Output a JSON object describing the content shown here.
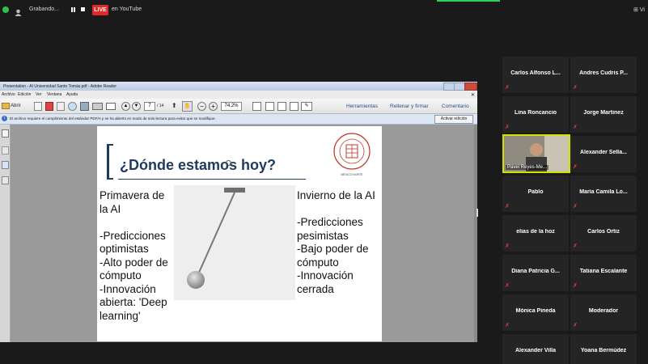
{
  "topbar": {
    "recording_label": "Grabando...",
    "live_badge": "LIVE",
    "stream_label": "en YouTube",
    "view_label": "Vi"
  },
  "reader": {
    "window_title": "Presentation - AI Universidad Santo Tomás.pdf - Adobe Reader",
    "menu": [
      "Archivo",
      "Edición",
      "Ver",
      "Ventana",
      "Ayuda"
    ],
    "open_label": "Abrir",
    "page_current": "7",
    "page_total": "/ 14",
    "zoom": "74,2%",
    "tools_button": "Herramientas",
    "sign_button": "Rellenar y firmar",
    "comment_button": "Comentario",
    "notice": "El archivo requiere el cumplimiento del estándar PDF/A y se ha abierto en modo de solo lectura para evitar que se modifique.",
    "enable_edit_button": "Activar edición"
  },
  "slide": {
    "title": "¿Dónde estamos hoy?",
    "left_text": "Primavera de\nla AI\n\n-Predicciones\noptimistas\n-Alto poder de\ncómputo\n-Innovación\nabierta: 'Deep\nlearning'",
    "right_text": "Invierno de la AI\n\n-Predicciones\npesimistas\n-Bajo poder de\ncómputo\n-Innovación\ncerrada",
    "logo_caption": "MÉXICO NORTE"
  },
  "participants": [
    {
      "name": "Carlos Alfonso L..."
    },
    {
      "name": "Andres Cudris P..."
    },
    {
      "name": "Lina Roncancio"
    },
    {
      "name": "Jorge Martinez"
    },
    {
      "name": "Pavel Reyes-Me...",
      "video": true
    },
    {
      "name": "Alexander Sella..."
    },
    {
      "name": "Pablo"
    },
    {
      "name": "María Camila Lo..."
    },
    {
      "name": "elias de la hoz"
    },
    {
      "name": "Carlos Ortiz"
    },
    {
      "name": "Diana Patricia G..."
    },
    {
      "name": "Tatiana Escalante"
    },
    {
      "name": "Mónica Pineda"
    },
    {
      "name": "Moderador"
    },
    {
      "name": "Alexander Villa"
    },
    {
      "name": "Yoana Bermúdez"
    }
  ],
  "colors": {
    "background": "#1a1a1a",
    "tile": "#242424",
    "live_red": "#e02828",
    "active_speaker": "#d4e000",
    "muted_mic": "#e23b3b"
  }
}
